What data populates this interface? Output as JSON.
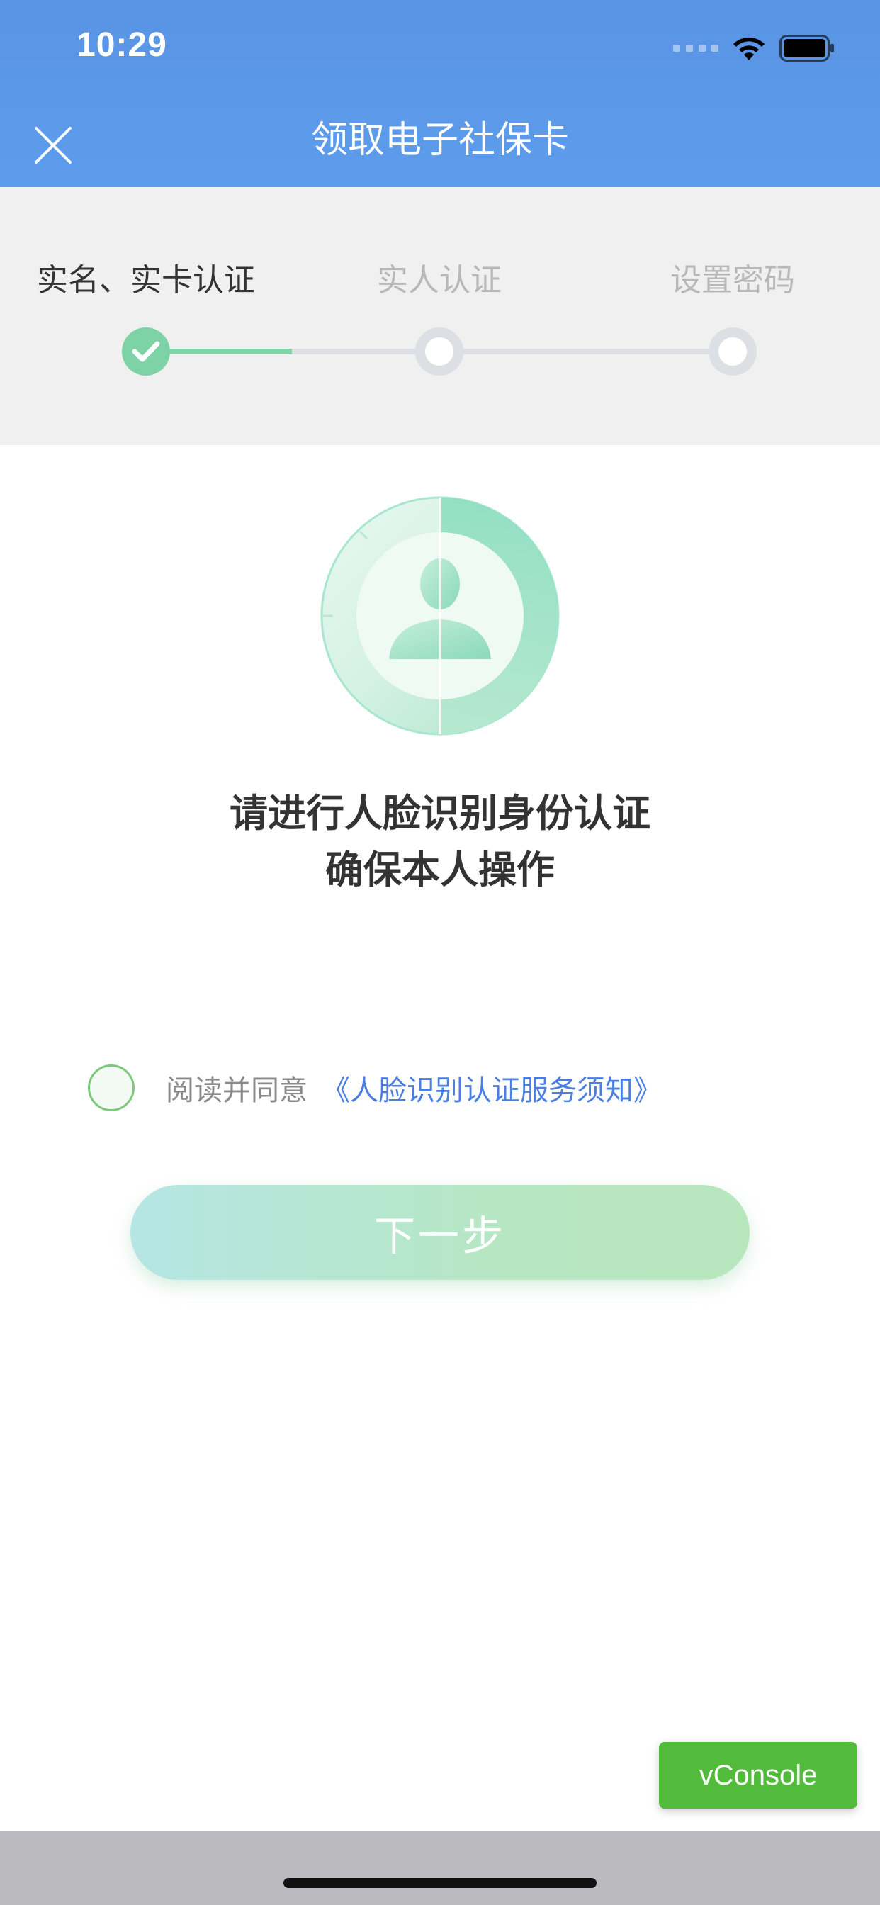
{
  "status_bar": {
    "time": "10:29",
    "icons": [
      "signal-icon",
      "wifi-icon",
      "battery-icon"
    ]
  },
  "header": {
    "title": "领取电子社保卡",
    "close_icon": "close-icon"
  },
  "stepper": {
    "steps": [
      {
        "label": "实名、实卡认证",
        "state": "done"
      },
      {
        "label": "实人认证",
        "state": "pending"
      },
      {
        "label": "设置密码",
        "state": "pending"
      }
    ]
  },
  "main": {
    "illustration_icon": "face-recognition-icon",
    "instruction_line1": "请进行人脸识别身份认证",
    "instruction_line2": "确保本人操作",
    "agree_text": "阅读并同意",
    "agree_link": "《人脸识别认证服务须知》",
    "agree_checked": false,
    "next_label": "下一步"
  },
  "debug": {
    "vconsole_label": "vConsole"
  },
  "colors": {
    "header_blue": "#5d9cec",
    "step_green": "#7dd3a5",
    "link_blue": "#4a7ee0",
    "vconsole_green": "#52bb3b"
  }
}
